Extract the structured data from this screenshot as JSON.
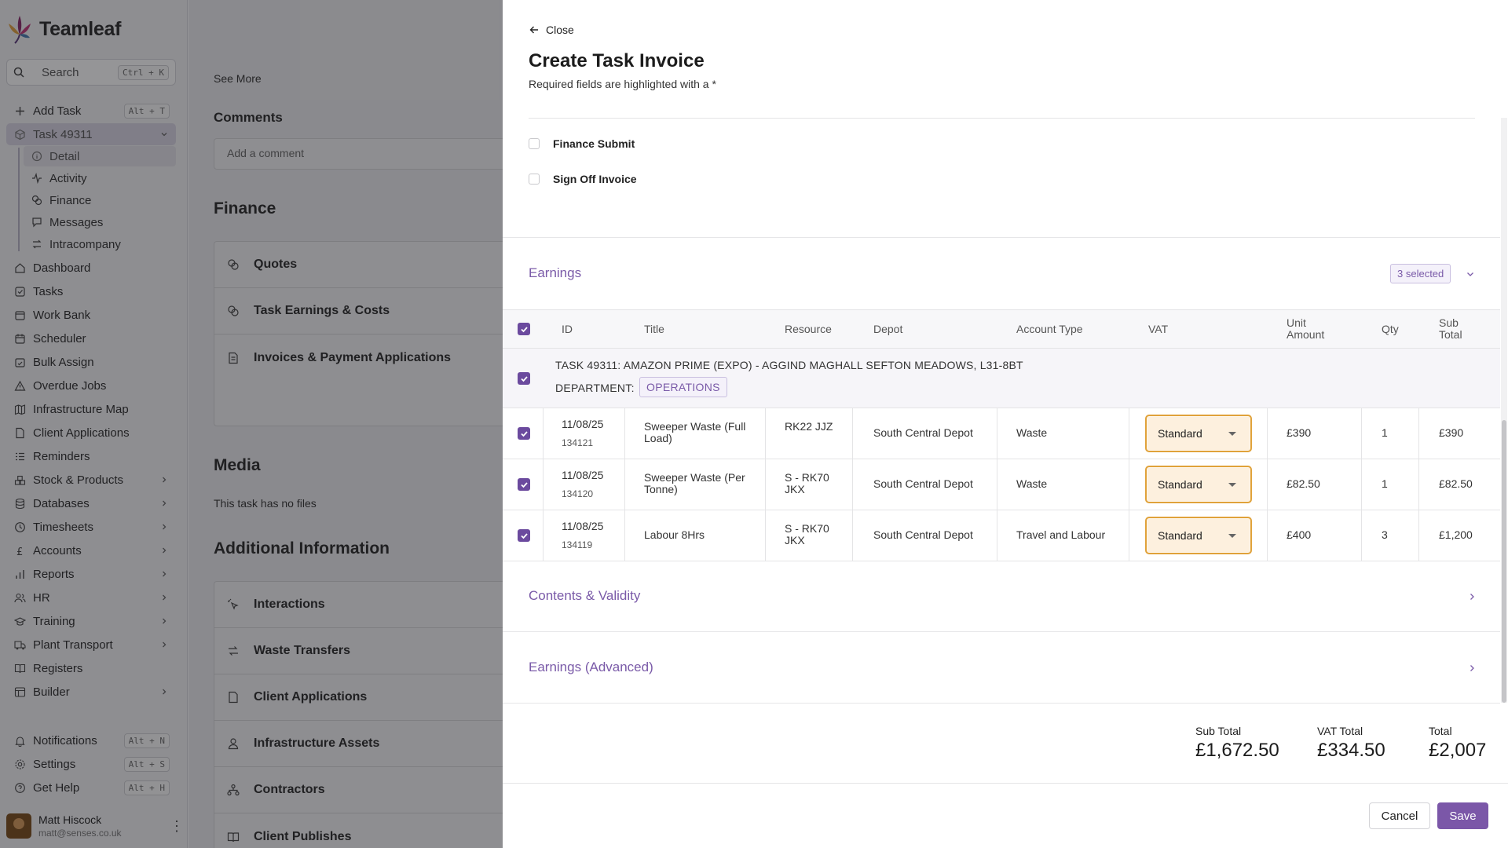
{
  "app": {
    "name": "Teamleaf"
  },
  "search": {
    "label": "Search",
    "shortcut": "Ctrl + K"
  },
  "nav": {
    "add_task": {
      "label": "Add Task",
      "shortcut": "Alt + T"
    },
    "task": {
      "label": "Task 49311"
    },
    "task_sub": [
      "Detail",
      "Activity",
      "Finance",
      "Messages",
      "Intracompany"
    ],
    "items": [
      "Dashboard",
      "Tasks",
      "Work Bank",
      "Scheduler",
      "Bulk Assign",
      "Overdue Jobs",
      "Infrastructure Map",
      "Client Applications",
      "Reminders",
      "Stock & Products",
      "Databases",
      "Timesheets",
      "Accounts",
      "Reports",
      "HR",
      "Training",
      "Plant Transport",
      "Registers",
      "Builder"
    ],
    "notifications": {
      "label": "Notifications",
      "shortcut": "Alt + N"
    },
    "settings": {
      "label": "Settings",
      "shortcut": "Alt + S"
    },
    "help": {
      "label": "Get Help",
      "shortcut": "Alt + H"
    }
  },
  "user": {
    "name": "Matt Hiscock",
    "email": "matt@senses.co.uk"
  },
  "background": {
    "see_more": "See More",
    "comments_title": "Comments",
    "comment_placeholder": "Add a comment",
    "finance_title": "Finance",
    "finance_items": [
      "Quotes",
      "Task Earnings & Costs",
      "Invoices & Payment Applications"
    ],
    "media_title": "Media",
    "media_empty": "This task has no files",
    "additional_title": "Additional Information",
    "additional_items": [
      "Interactions",
      "Waste Transfers",
      "Client Applications",
      "Infrastructure Assets",
      "Contractors",
      "Client Publishes"
    ]
  },
  "drawer": {
    "close": "Close",
    "title": "Create Task Invoice",
    "subtitle": "Required fields are highlighted with a *",
    "checks": [
      "Finance Submit",
      "Sign Off Invoice"
    ],
    "earnings": {
      "title": "Earnings",
      "selected": "3 selected",
      "columns": [
        "ID",
        "Title",
        "Resource",
        "Depot",
        "Account Type",
        "VAT",
        "Unit Amount",
        "Qty",
        "Sub Total"
      ],
      "group": {
        "title": "TASK 49311: AMAZON PRIME (EXPO) - AGGIND MAGHALL SEFTON MEADOWS, L31-8BT",
        "dept_label": "DEPARTMENT:",
        "dept": "OPERATIONS"
      },
      "rows": [
        {
          "date": "11/08/25",
          "id": "134121",
          "title": "Sweeper Waste (Full Load)",
          "resource": "RK22 JJZ",
          "depot": "South Central Depot",
          "account": "Waste",
          "vat": "Standard",
          "unit": "£390",
          "qty": "1",
          "subtotal": "£390"
        },
        {
          "date": "11/08/25",
          "id": "134120",
          "title": "Sweeper Waste (Per Tonne)",
          "resource": "S - RK70 JKX",
          "depot": "South Central Depot",
          "account": "Waste",
          "vat": "Standard",
          "unit": "£82.50",
          "qty": "1",
          "subtotal": "£82.50"
        },
        {
          "date": "11/08/25",
          "id": "134119",
          "title": "Labour 8Hrs",
          "resource": "S - RK70 JKX",
          "depot": "South Central Depot",
          "account": "Travel and Labour",
          "vat": "Standard",
          "unit": "£400",
          "qty": "3",
          "subtotal": "£1,200"
        }
      ]
    },
    "contents_title": "Contents & Validity",
    "advanced_title": "Earnings (Advanced)",
    "totals": [
      {
        "label": "Sub Total",
        "value": "£1,672.50"
      },
      {
        "label": "VAT Total",
        "value": "£334.50"
      },
      {
        "label": "Total",
        "value": "£2,007"
      }
    ],
    "cancel": "Cancel",
    "save": "Save"
  },
  "colors": {
    "accent": "#7b57a8",
    "vat_border": "#e0a23a"
  }
}
